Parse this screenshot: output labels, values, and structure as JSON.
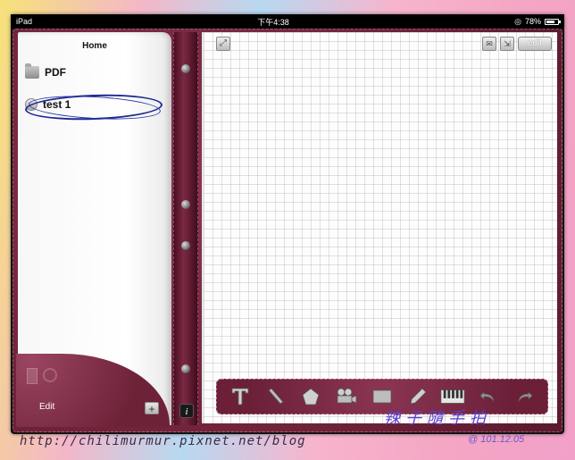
{
  "status_bar": {
    "device": "iPad",
    "time": "下午4:38",
    "battery_text": "78%",
    "battery_level": 0.78
  },
  "sidebar": {
    "title": "Home",
    "items": [
      {
        "label": "PDF",
        "icon": "folder-icon"
      },
      {
        "label": "test 1",
        "icon": "note-icon"
      }
    ],
    "edit_label": "Edit",
    "add_label": "+"
  },
  "spine": {
    "info_label": "i"
  },
  "canvas_toolbar": {
    "edit_label": "edit",
    "zoom_icon": "zoom-icon",
    "mail_icon": "mail-icon",
    "export_icon": "export-icon"
  },
  "tools": [
    {
      "name": "text-tool",
      "icon": "text-icon"
    },
    {
      "name": "line-tool",
      "icon": "line-icon"
    },
    {
      "name": "shape-tool",
      "icon": "pentagon-icon"
    },
    {
      "name": "video-tool",
      "icon": "camera-icon"
    },
    {
      "name": "rectangle-tool",
      "icon": "rectangle-icon"
    },
    {
      "name": "pen-tool",
      "icon": "pen-icon"
    },
    {
      "name": "audio-tool",
      "icon": "piano-icon"
    },
    {
      "name": "undo-tool",
      "icon": "undo-icon"
    },
    {
      "name": "redo-tool",
      "icon": "redo-icon"
    }
  ],
  "watermark": {
    "url": "http://chilimurmur.pixnet.net/blog",
    "signature": "辣子隨手拍",
    "date": "@ 101.12.05"
  },
  "colors": {
    "leather": "#6e2238",
    "annotation_ink": "#1d2a8f",
    "signature_ink": "#5b3ec9"
  }
}
